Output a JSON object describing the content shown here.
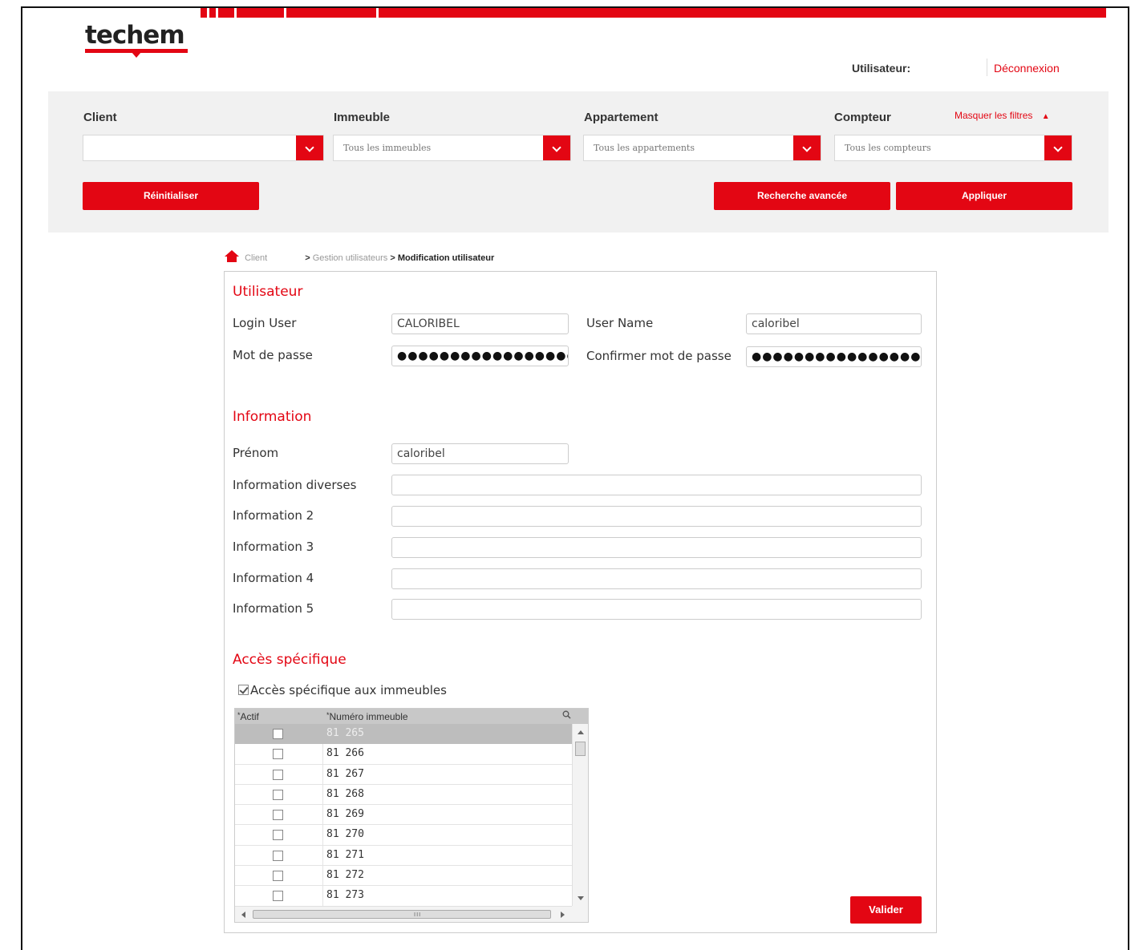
{
  "brand": {
    "logo_text": "techem",
    "accent_color": "#e30613"
  },
  "header": {
    "user_label": "Utilisateur:",
    "logout_label": "Déconnexion"
  },
  "filters": {
    "client_label": "Client",
    "client_value": "",
    "building_label": "Immeuble",
    "building_value": "Tous les immeubles",
    "apartment_label": "Appartement",
    "apartment_value": "Tous les appartements",
    "meter_label": "Compteur",
    "meter_value": "Tous les compteurs",
    "hide_filters_label": "Masquer les filtres",
    "reset_label": "Réinitialiser",
    "advanced_search_label": "Recherche avancée",
    "apply_label": "Appliquer"
  },
  "breadcrumb": {
    "home": "Client",
    "sep": ">",
    "level1": "Gestion utilisateurs",
    "current": "Modification utilisateur"
  },
  "user_section": {
    "title": "Utilisateur",
    "login_label": "Login User",
    "login_value": "CALORIBEL",
    "username_label": "User Name",
    "username_value": "caloribel",
    "password_label": "Mot de passe",
    "password_value": "●●●●●●●●●●●●●●●●●●",
    "confirm_label": "Confirmer mot de passe",
    "confirm_value": "●●●●●●●●●●●●●●●●●●"
  },
  "info_section": {
    "title": "Information",
    "firstname_label": "Prénom",
    "firstname_value": "caloribel",
    "misc_label": "Information diverses",
    "misc_value": "",
    "info2_label": "Information 2",
    "info2_value": "",
    "info3_label": "Information 3",
    "info3_value": "",
    "info4_label": "Information 4",
    "info4_value": "",
    "info5_label": "Information 5",
    "info5_value": ""
  },
  "access_section": {
    "title": "Accès spécifique",
    "checkbox_label": "Accès spécifique aux immeubles",
    "checkbox_checked": true,
    "grid": {
      "col_active": "Actif",
      "col_number": "Numéro immeuble",
      "sort_marker": "*",
      "search_icon": "search-icon",
      "rows": [
        {
          "number": "81 265",
          "active": false,
          "selected": true
        },
        {
          "number": "81 266",
          "active": false,
          "selected": false
        },
        {
          "number": "81 267",
          "active": false,
          "selected": false
        },
        {
          "number": "81 268",
          "active": false,
          "selected": false
        },
        {
          "number": "81 269",
          "active": false,
          "selected": false
        },
        {
          "number": "81 270",
          "active": false,
          "selected": false
        },
        {
          "number": "81 271",
          "active": false,
          "selected": false
        },
        {
          "number": "81 272",
          "active": false,
          "selected": false
        },
        {
          "number": "81 273",
          "active": false,
          "selected": false
        }
      ],
      "hscroll_grip": "III"
    }
  },
  "submit_label": "Valider"
}
